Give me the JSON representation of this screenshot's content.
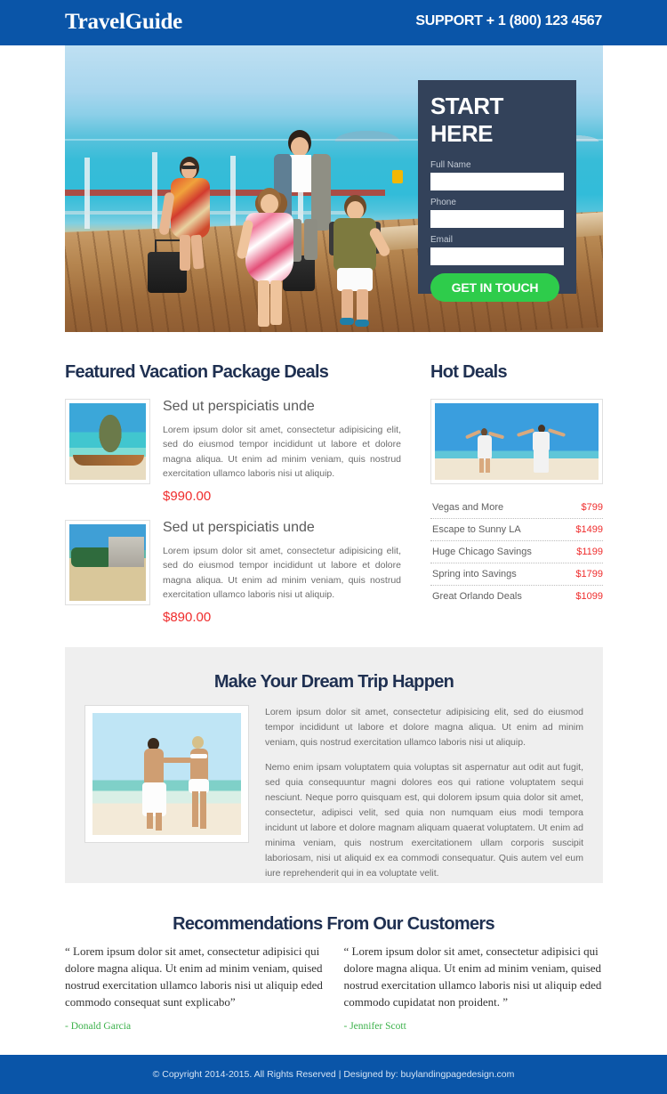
{
  "header": {
    "logo": "TravelGuide",
    "support": "SUPPORT + 1 (800) 123 4567"
  },
  "hero": {
    "image_alt": "family-walking-on-pier",
    "form": {
      "title": "START HERE",
      "fields": [
        {
          "label": "Full Name",
          "value": "",
          "placeholder": ""
        },
        {
          "label": "Phone",
          "value": "",
          "placeholder": ""
        },
        {
          "label": "Email",
          "value": "",
          "placeholder": ""
        }
      ],
      "cta_label": "GET IN TOUCH",
      "cta_color": "#2ecc4b",
      "panel_color": "#33425a"
    }
  },
  "featured": {
    "heading": "Featured Vacation Package Deals",
    "deals": [
      {
        "image_alt": "thailand-beach-longtail-boats",
        "title": "Sed ut perspiciatis unde",
        "text": "Lorem ipsum dolor sit amet, consectetur adipisicing elit, sed do eiusmod tempor incididunt ut labore et dolore magna aliqua. Ut enim ad minim veniam, quis nostrud exercitation ullamco laboris nisi ut aliquip.",
        "price": "$990.00"
      },
      {
        "image_alt": "resort-beach-with-hotels",
        "title": "Sed ut perspiciatis unde",
        "text": "Lorem ipsum dolor sit amet, consectetur adipisicing elit, sed do eiusmod tempor incididunt ut labore et dolore magna aliqua. Ut enim ad minim veniam, quis nostrud exercitation ullamco laboris nisi ut aliquip.",
        "price": "$890.00"
      }
    ]
  },
  "hot_deals": {
    "heading": "Hot Deals",
    "image_alt": "couple-arms-outstretched-on-beach",
    "items": [
      {
        "name": "Vegas and More",
        "price": "$799"
      },
      {
        "name": "Escape to Sunny LA",
        "price": "$1499"
      },
      {
        "name": "Huge Chicago Savings",
        "price": "$1199"
      },
      {
        "name": "Spring into Savings",
        "price": "$1799"
      },
      {
        "name": "Great Orlando Deals",
        "price": "$1099"
      }
    ]
  },
  "dream": {
    "heading": "Make Your Dream Trip Happen",
    "image_alt": "couple-holding-hands-on-beach",
    "paragraphs": [
      "Lorem ipsum dolor sit amet, consectetur adipisicing elit, sed do eiusmod tempor incididunt ut labore et dolore magna aliqua. Ut enim ad minim veniam, quis nostrud exercitation ullamco laboris nisi ut aliquip.",
      "Nemo enim ipsam voluptatem quia voluptas sit aspernatur aut odit aut fugit, sed quia consequuntur magni dolores eos qui ratione voluptatem sequi nesciunt. Neque porro quisquam est, qui dolorem ipsum quia dolor sit amet, consectetur, adipisci velit, sed quia non numquam eius modi tempora incidunt ut labore et dolore magnam aliquam quaerat voluptatem. Ut enim ad minima veniam, quis nostrum exercitationem ullam corporis suscipit laboriosam, nisi ut aliquid ex ea commodi consequatur. Quis autem vel eum iure reprehenderit qui in ea voluptate velit."
    ]
  },
  "testimonials": {
    "heading": "Recommendations From Our Customers",
    "items": [
      {
        "text": "“ Lorem ipsum dolor sit amet, consectetur adipisici qui dolore magna aliqua. Ut enim ad minim veniam, quised nostrud exercitation ullamco laboris nisi ut aliquip eded commodo consequat sunt explicabo”",
        "author": "- Donald Garcia"
      },
      {
        "text": "“ Lorem ipsum dolor sit amet, consectetur adipisici qui dolore magna aliqua. Ut enim ad minim veniam, quised nostrud exercitation ullamco laboris nisi ut aliquip eded commodo cupidatat non proident. ”",
        "author": "- Jennifer Scott"
      }
    ]
  },
  "footer": {
    "text": "© Copyright 2014-2015. All Rights Reserved  |  Designed by: buylandingpagedesign.com"
  },
  "theme": {
    "brand_blue": "#0a55a8",
    "heading_navy": "#1f3051",
    "price_red": "#ef2d2d",
    "author_green": "#3bb14a",
    "panel_gray": "#efefef"
  }
}
